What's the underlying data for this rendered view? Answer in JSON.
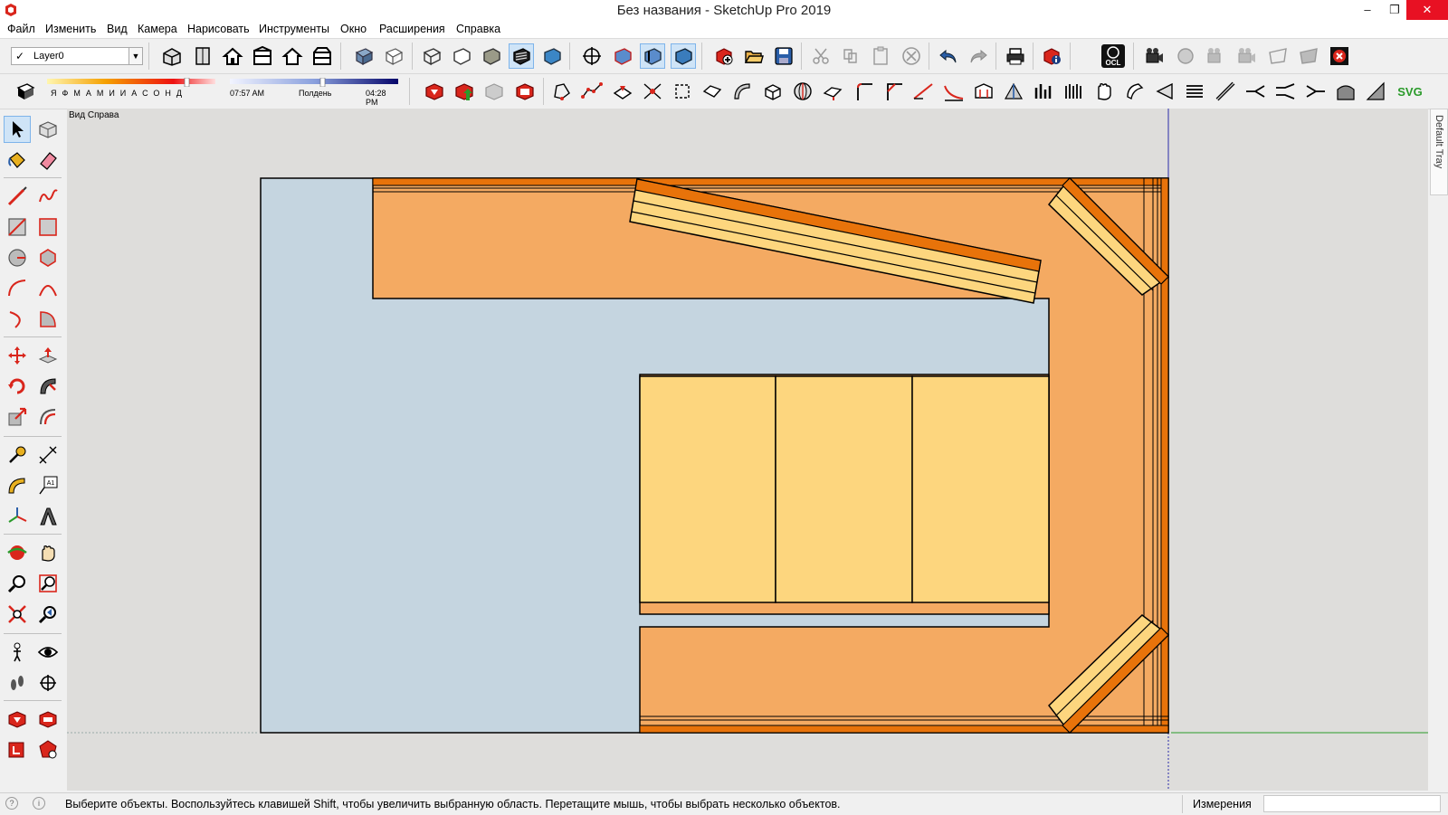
{
  "window": {
    "title": "Без названия - SketchUp Pro 2019",
    "minimize": "–",
    "restore": "❐",
    "close": "✕"
  },
  "menu": [
    "Файл",
    "Изменить",
    "Вид",
    "Камера",
    "Нарисовать",
    "Инструменты",
    "Окно",
    "Расширения",
    "Справка"
  ],
  "layer": {
    "check": "✓",
    "name": "Layer0"
  },
  "shadows": {
    "months": "ЯФМАМИИАСОНД",
    "time_start": "07:57 AM",
    "time_mid": "Полдень",
    "time_end": "04:28 PM"
  },
  "toolbar_extra": {
    "ocl_label": "OCL",
    "svg_label": "SVG"
  },
  "viewport": {
    "view_name": "Вид Справа"
  },
  "tray": {
    "label": "Default Tray"
  },
  "status": {
    "message": "Выберите объекты. Воспользуйтесь клавишей Shift, чтобы увеличить выбранную область. Перетащите мышь, чтобы выбрать несколько объектов.",
    "measurements_label": "Измерения",
    "measurements_value": ""
  },
  "colors": {
    "background_canvas": "#dedddb",
    "wall_fill": "#c5d5e0",
    "furniture_orange": "#f4aa62",
    "accent_orange": "#e8730a",
    "cushion_yellow": "#fdd67e",
    "active_tool": "#cfe4f7"
  },
  "icons": {
    "left_toolbar": [
      "select-icon",
      "make-component-icon",
      "paint-bucket-icon",
      "eraser-icon",
      "line-icon",
      "freehand-icon",
      "rectangle-icon",
      "rotated-rectangle-icon",
      "circle-icon",
      "polygon-icon",
      "arc-icon",
      "two-point-arc-icon",
      "three-point-arc-icon",
      "pie-icon",
      "move-icon",
      "push-pull-icon",
      "rotate-icon",
      "follow-me-icon",
      "scale-icon",
      "offset-icon",
      "tape-measure-icon",
      "dimension-icon",
      "protractor-icon",
      "text-icon",
      "axes-icon",
      "3d-text-icon",
      "orbit-icon",
      "pan-icon",
      "zoom-icon",
      "zoom-window-icon",
      "zoom-extents-icon",
      "previous-view-icon",
      "position-camera-icon",
      "look-around-icon",
      "walk-icon",
      "section-plane-icon",
      "warehouse-icon",
      "extension-warehouse-icon",
      "send-to-layout-icon",
      "extension-manager-icon"
    ]
  }
}
